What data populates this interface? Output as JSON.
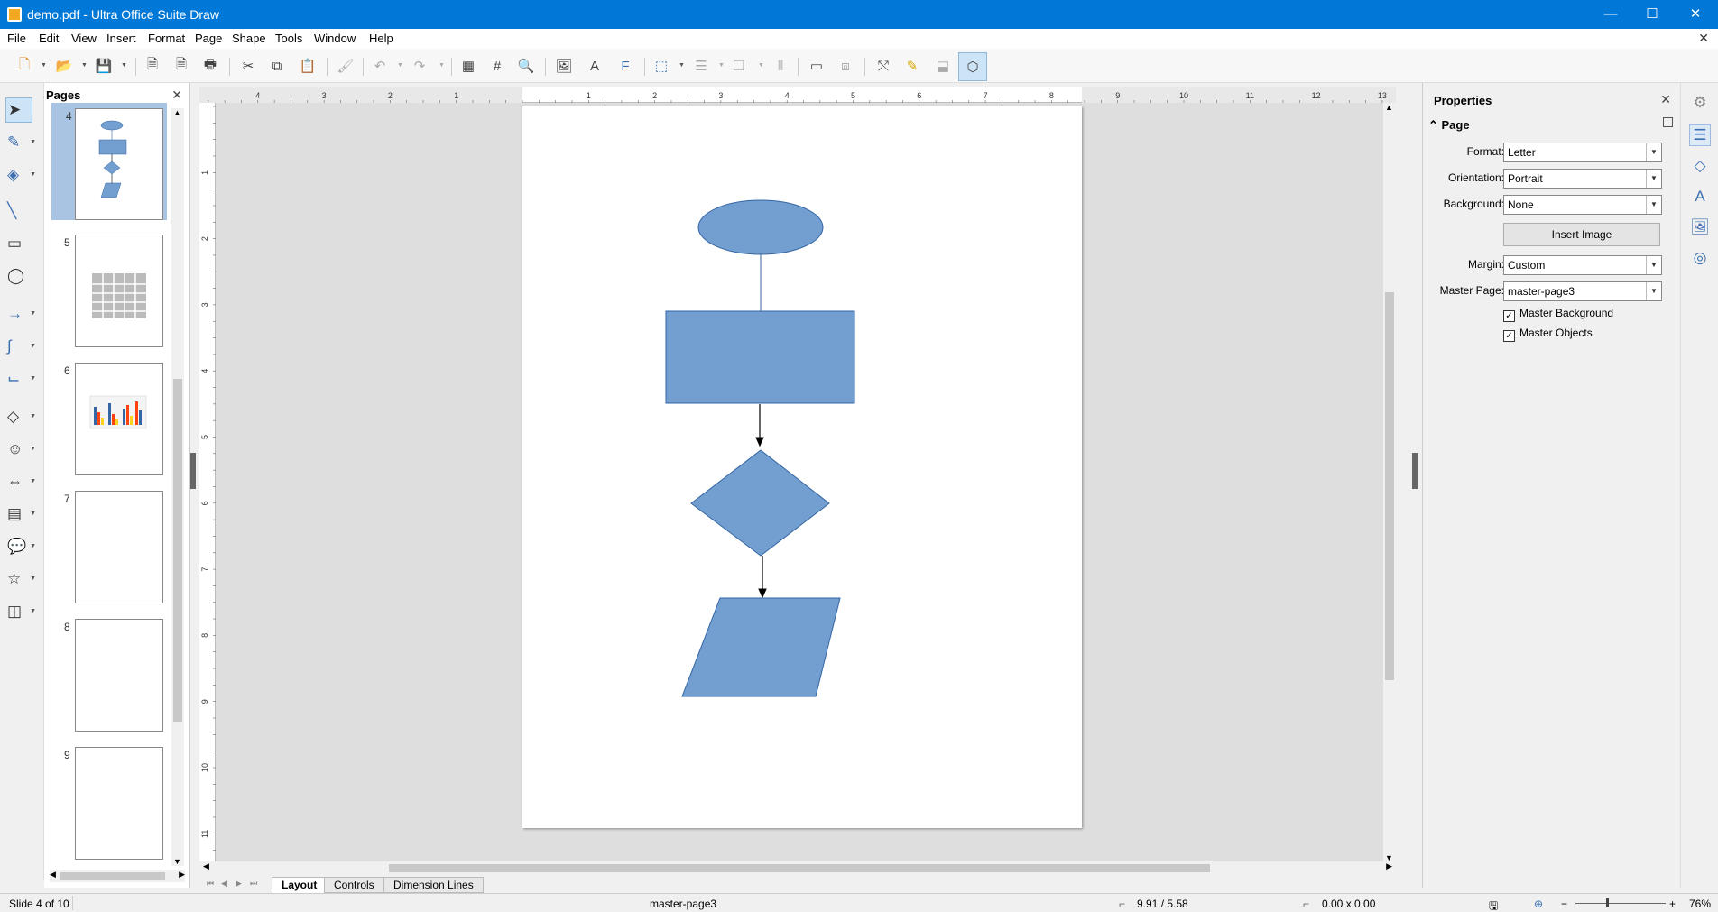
{
  "window": {
    "title": "demo.pdf - Ultra Office Suite Draw"
  },
  "window_controls": {
    "minimize": "—",
    "maximize": "☐",
    "close": "✕"
  },
  "menu": [
    "File",
    "Edit",
    "View",
    "Insert",
    "Format",
    "Page",
    "Shape",
    "Tools",
    "Window",
    "Help"
  ],
  "pages_panel": {
    "title": "Pages",
    "close": "✕",
    "thumbnails": [
      {
        "number": "4",
        "content": "flowchart",
        "selected": true
      },
      {
        "number": "5",
        "content": "table"
      },
      {
        "number": "6",
        "content": "chart"
      },
      {
        "number": "7",
        "content": "blank"
      },
      {
        "number": "8",
        "content": "blank"
      },
      {
        "number": "9",
        "content": "blank"
      }
    ]
  },
  "ruler": {
    "horizontal_labels": [
      "4",
      "3",
      "2",
      "1",
      "1",
      "2",
      "3",
      "4",
      "5",
      "6",
      "7",
      "8",
      "9",
      "10",
      "11",
      "12",
      "13"
    ],
    "vertical_labels": [
      "1",
      "2",
      "3",
      "4",
      "5",
      "6",
      "7",
      "8",
      "9",
      "10",
      "11"
    ]
  },
  "canvas": {
    "page_background": "#ffffff",
    "shape_fill": "#729fcf",
    "shape_stroke": "#3465a4"
  },
  "bottom_tabs": [
    "Layout",
    "Controls",
    "Dimension Lines"
  ],
  "properties": {
    "title": "Properties",
    "close": "✕",
    "section": "Page",
    "fields": {
      "format": {
        "label": "Format:",
        "value": "Letter"
      },
      "orientation": {
        "label": "Orientation:",
        "value": "Portrait"
      },
      "background": {
        "label": "Background:",
        "value": "None"
      },
      "insert_image": "Insert Image",
      "margin": {
        "label": "Margin:",
        "value": "Custom"
      },
      "master_page": {
        "label": "Master Page:",
        "value": "master-page3"
      }
    },
    "checkboxes": [
      {
        "label": "Master Background",
        "checked": true
      },
      {
        "label": "Master Objects",
        "checked": true
      }
    ]
  },
  "status": {
    "slide": "Slide 4 of 10",
    "master": "master-page3",
    "position": "9.91 / 5.58",
    "size": "0.00 x 0.00",
    "zoom": "76%"
  },
  "colors": {
    "titlebar": "#0078d7",
    "accent": "#729fcf"
  }
}
